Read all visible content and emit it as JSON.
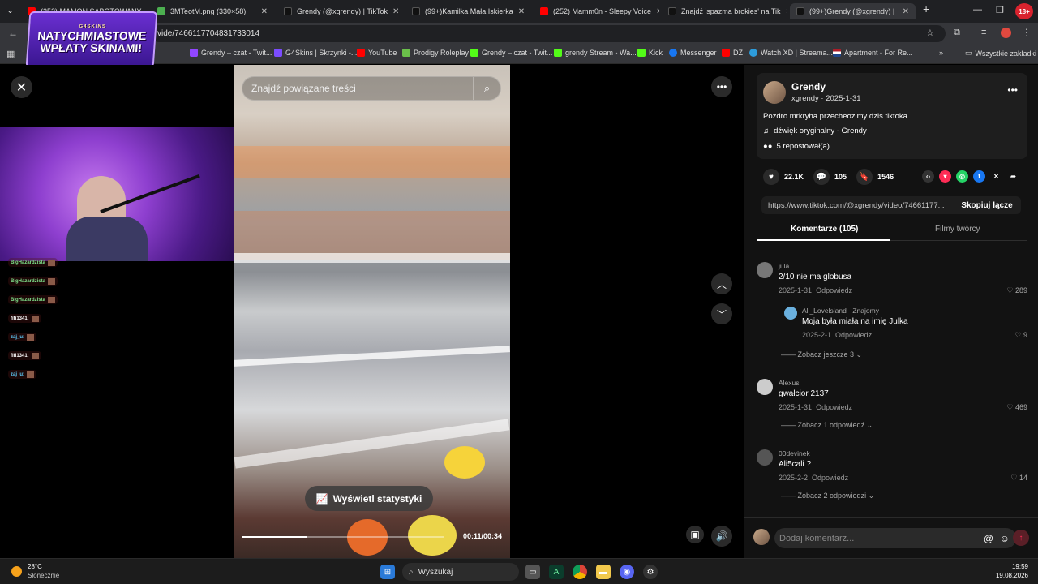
{
  "tabs": [
    {
      "label": "(252) MAMON SABOTOWANY",
      "color": "#ff0000"
    },
    {
      "label": "3MTeotM.png (330×58)",
      "color": "#4caf50"
    },
    {
      "label": "Grendy (@xgrendy) | TikTok",
      "color": "#000000"
    },
    {
      "label": "(99+)Kamilka Mała Iskierka",
      "color": "#000000"
    },
    {
      "label": "(252) Mamm0n - Sleepy Voice",
      "color": "#ff0000"
    },
    {
      "label": "Znajdź 'spazma brokies' na Tik",
      "color": "#000000"
    },
    {
      "label": "(99+)Grendy (@xgrendy) |",
      "color": "#000000"
    }
  ],
  "notif_badge": "18+",
  "address": {
    "url": "vide/7466117704831733014"
  },
  "bookmarks": [
    "Grendy – czat - Twit...",
    "G4Skins | Skrzynki -...",
    "YouTube",
    "Prodigy Roleplay",
    "Grendy – czat - Twit...",
    "grendy Stream - Wa...",
    "Kick",
    "Messenger",
    "DZ",
    "Watch XD | Streama...",
    "Apartment - For Re..."
  ],
  "bookmarks_all": "Wszystkie zakładki",
  "ad": {
    "brand": "G4SKINS",
    "line1": "NATYCHMIASTOWE",
    "line2": "WPŁATY SKINAMI!"
  },
  "video": {
    "search_placeholder": "Znajdź powiązane treści",
    "stats_button": "Wyświetl statystyki",
    "time": "00:11/00:34",
    "progress": 0.32
  },
  "chat": [
    {
      "name": "BigHazardzista",
      "color": "#7fe08a"
    },
    {
      "name": "BigHazardzista",
      "color": "#7fe08a"
    },
    {
      "name": "BigHazardzista",
      "color": "#7fe08a"
    },
    {
      "name": "fifi1341:",
      "color": "#ffffff"
    },
    {
      "name": "zaj_u:",
      "color": "#5fd0ff"
    },
    {
      "name": "fifi1341:",
      "color": "#ffffff"
    },
    {
      "name": "zaj_u:",
      "color": "#5fd0ff"
    }
  ],
  "post": {
    "author": "Grendy",
    "handle": "xgrendy · 2025-1-31",
    "caption": "Pozdro mrkryha przecheozimy dzis tiktoka",
    "sound": "dźwięk oryginalny - Grendy",
    "reposts": "5 repostował(a)",
    "likes": "22.1K",
    "comments": "105",
    "saves": "1546",
    "link": "https://www.tiktok.com/@xgrendy/video/74661177...",
    "copy": "Skopiuj łącze"
  },
  "panel_tabs": {
    "comments": "Komentarze (105)",
    "creator": "Filmy twórcy"
  },
  "comments": [
    {
      "user": "jula",
      "text": "2/10 nie ma globusa",
      "date": "2025-1-31",
      "reply": "Odpowiedz",
      "likes": "289"
    },
    {
      "user": "Ali_Lovelsland · Znajomy",
      "text": "Moja była miała na imię Julka",
      "date": "2025-2-1",
      "reply": "Odpowiedz",
      "likes": "9"
    },
    {
      "user": "Alexus",
      "text": "gwałcior 2137",
      "date": "2025-1-31",
      "reply": "Odpowiedz",
      "likes": "469"
    },
    {
      "user": "00devinek",
      "text": "Ali5cali ?",
      "date": "2025-2-2",
      "reply": "Odpowiedz",
      "likes": "14"
    }
  ],
  "more_links": [
    "Zobacz jeszcze 3",
    "Zobacz 1 odpowiedź",
    "Zobacz 2 odpowiedzi"
  ],
  "comment_placeholder": "Dodaj komentarz...",
  "taskbar": {
    "weather_temp": "28°C",
    "weather_desc": "Słonecznie",
    "search": "Wyszukaj",
    "time": "19:59",
    "date": "19.08.2026"
  }
}
